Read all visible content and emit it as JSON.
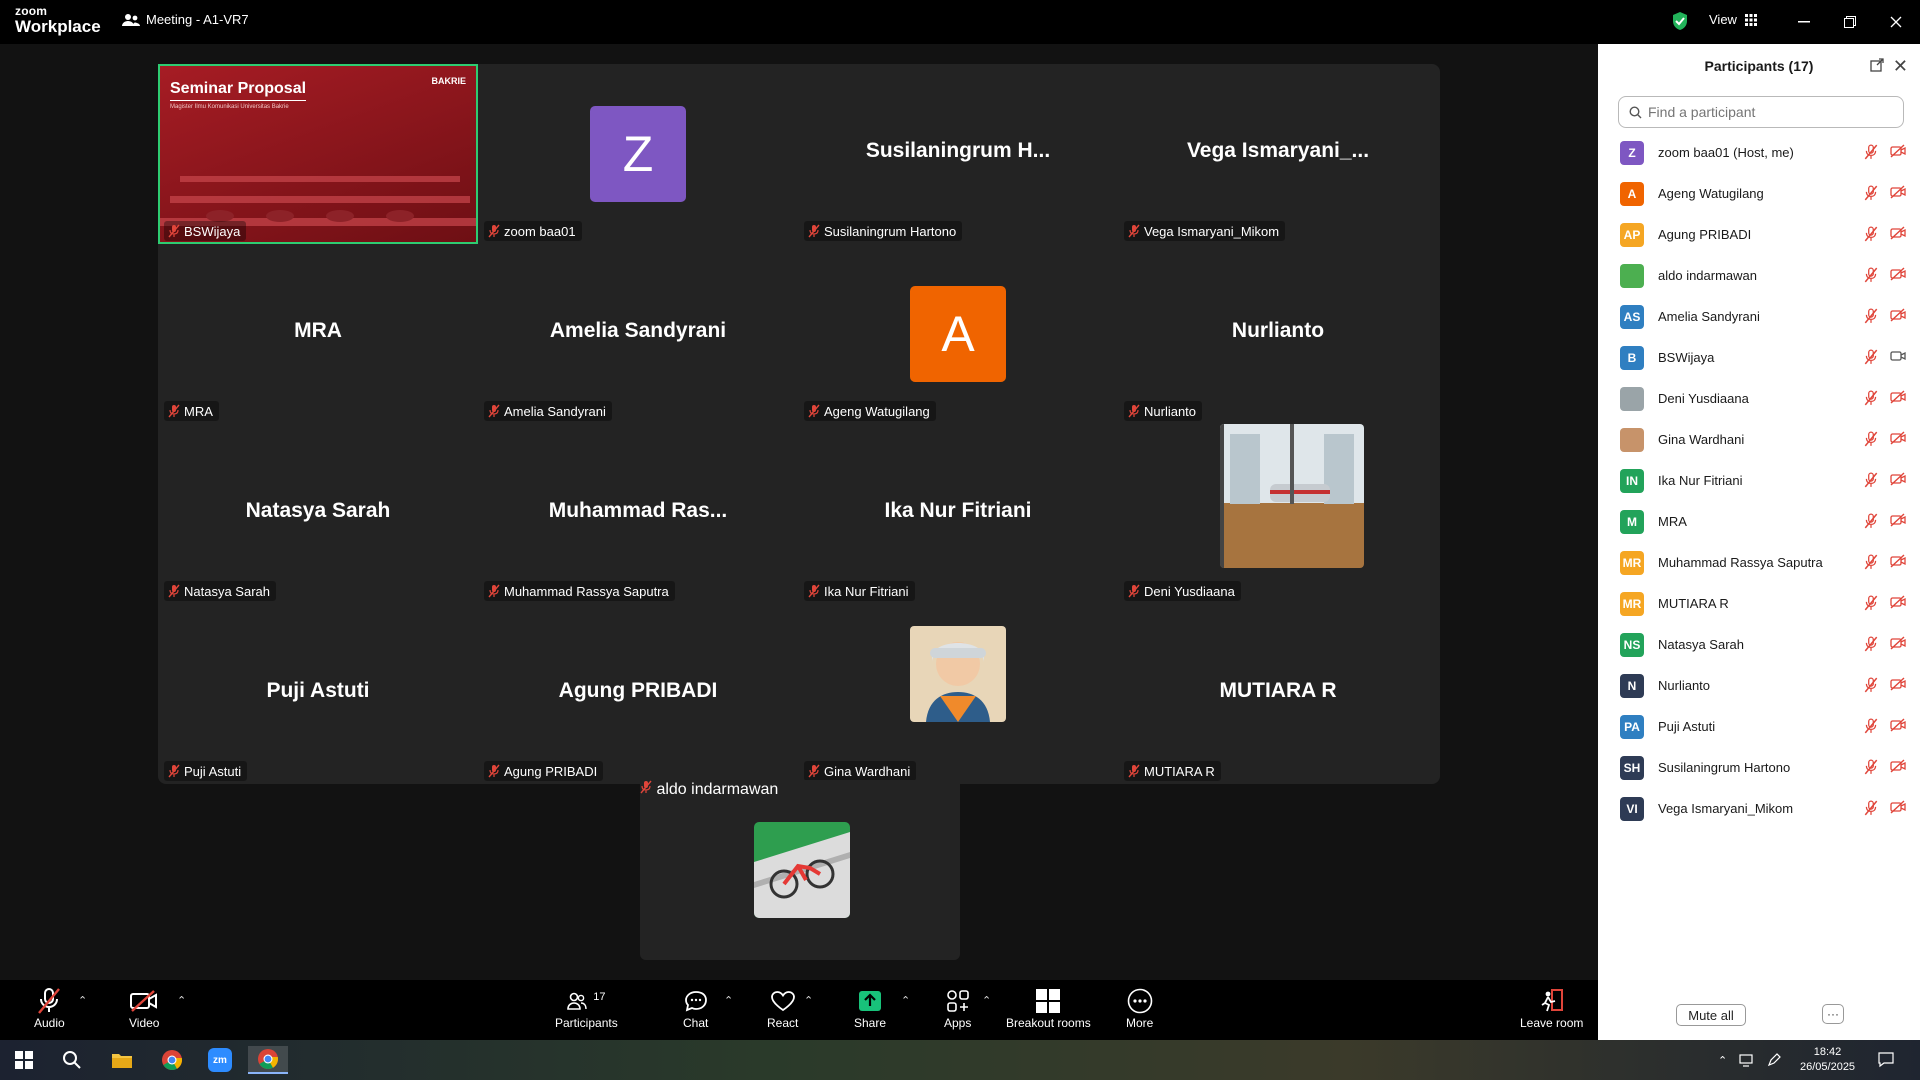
{
  "app": {
    "logo_line1": "zoom",
    "logo_line2": "Workplace",
    "meeting_title": "Meeting - A1-VR7",
    "view_label": "View"
  },
  "tiles": [
    {
      "name": "BSWijaya",
      "display": "",
      "type": "slide"
    },
    {
      "name": "zoom baa01",
      "display": "Z",
      "type": "avatar",
      "color": "#7e57c2"
    },
    {
      "name": "Susilaningrum Hartono",
      "display": "Susilaningrum  H...",
      "type": "text"
    },
    {
      "name": "Vega Ismaryani_Mikom",
      "display": "Vega  Ismaryani_...",
      "type": "text"
    },
    {
      "name": "MRA",
      "display": "MRA",
      "type": "text"
    },
    {
      "name": "Amelia Sandyrani",
      "display": "Amelia Sandyrani",
      "type": "text"
    },
    {
      "name": "Ageng Watugilang",
      "display": "A",
      "type": "avatar",
      "color": "#f06400"
    },
    {
      "name": "Nurlianto",
      "display": "Nurlianto",
      "type": "text"
    },
    {
      "name": "Natasya Sarah",
      "display": "Natasya Sarah",
      "type": "text"
    },
    {
      "name": "Muhammad Rassya Saputra",
      "display": "Muhammad  Ras...",
      "type": "text"
    },
    {
      "name": "Ika Nur Fitriani",
      "display": "Ika Nur Fitriani",
      "type": "text"
    },
    {
      "name": "Deni Yusdiaana",
      "display": "",
      "type": "photo-room"
    },
    {
      "name": "Puji Astuti",
      "display": "Puji Astuti",
      "type": "text"
    },
    {
      "name": "Agung PRIBADI",
      "display": "Agung PRIBADI",
      "type": "text"
    },
    {
      "name": "Gina Wardhani",
      "display": "",
      "type": "photo-person"
    },
    {
      "name": "MUTIARA R",
      "display": "MUTIARA R",
      "type": "text"
    }
  ],
  "last_tile": {
    "name": "aldo indarmawan"
  },
  "slide": {
    "title": "Seminar Proposal",
    "subtitle": "Magister Ilmu Komunikasi Universitas Bakrie",
    "brand": "BAKRIE"
  },
  "toolbar": {
    "audio": "Audio",
    "video": "Video",
    "participants": "Participants",
    "participants_count": "17",
    "chat": "Chat",
    "react": "React",
    "share": "Share",
    "apps": "Apps",
    "breakout": "Breakout rooms",
    "more": "More",
    "leave": "Leave room"
  },
  "panel": {
    "title": "Participants (17)",
    "search_placeholder": "Find a participant",
    "mute_all": "Mute all",
    "more": "···"
  },
  "participants": [
    {
      "initials": "Z",
      "name": "zoom baa01 (Host, me)",
      "color": "#7e57c2",
      "video": "off"
    },
    {
      "initials": "A",
      "name": "Ageng Watugilang",
      "color": "#f06400",
      "video": "off"
    },
    {
      "initials": "AP",
      "name": "Agung PRIBADI",
      "color": "#f5a623",
      "video": "off"
    },
    {
      "initials": "",
      "name": "aldo indarmawan",
      "color": "#4caf50",
      "video": "off"
    },
    {
      "initials": "AS",
      "name": "Amelia Sandyrani",
      "color": "#2f7fc1",
      "video": "off"
    },
    {
      "initials": "B",
      "name": "BSWijaya",
      "color": "#2f7fc1",
      "video": "on"
    },
    {
      "initials": "",
      "name": "Deni Yusdiaana",
      "color": "#9aa4a8",
      "video": "off"
    },
    {
      "initials": "",
      "name": "Gina Wardhani",
      "color": "#c7936a",
      "video": "off"
    },
    {
      "initials": "IN",
      "name": "Ika Nur Fitriani",
      "color": "#22a35a",
      "video": "off"
    },
    {
      "initials": "M",
      "name": "MRA",
      "color": "#22a35a",
      "video": "off"
    },
    {
      "initials": "MR",
      "name": "Muhammad Rassya Saputra",
      "color": "#f5a623",
      "video": "off"
    },
    {
      "initials": "MR",
      "name": "MUTIARA R",
      "color": "#f5a623",
      "video": "off"
    },
    {
      "initials": "NS",
      "name": "Natasya Sarah",
      "color": "#22a35a",
      "video": "off"
    },
    {
      "initials": "N",
      "name": "Nurlianto",
      "color": "#2e3b55",
      "video": "off"
    },
    {
      "initials": "PA",
      "name": "Puji Astuti",
      "color": "#2f7fc1",
      "video": "off"
    },
    {
      "initials": "SH",
      "name": "Susilaningrum Hartono",
      "color": "#2e3b55",
      "video": "off"
    },
    {
      "initials": "VI",
      "name": "Vega Ismaryani_Mikom",
      "color": "#2e3b55",
      "video": "off"
    }
  ],
  "tray": {
    "time": "18:42",
    "date": "26/05/2025"
  },
  "colors": {
    "accent_green": "#2ecc71",
    "mute_red": "#e0453a",
    "share_green": "#18c27a"
  }
}
